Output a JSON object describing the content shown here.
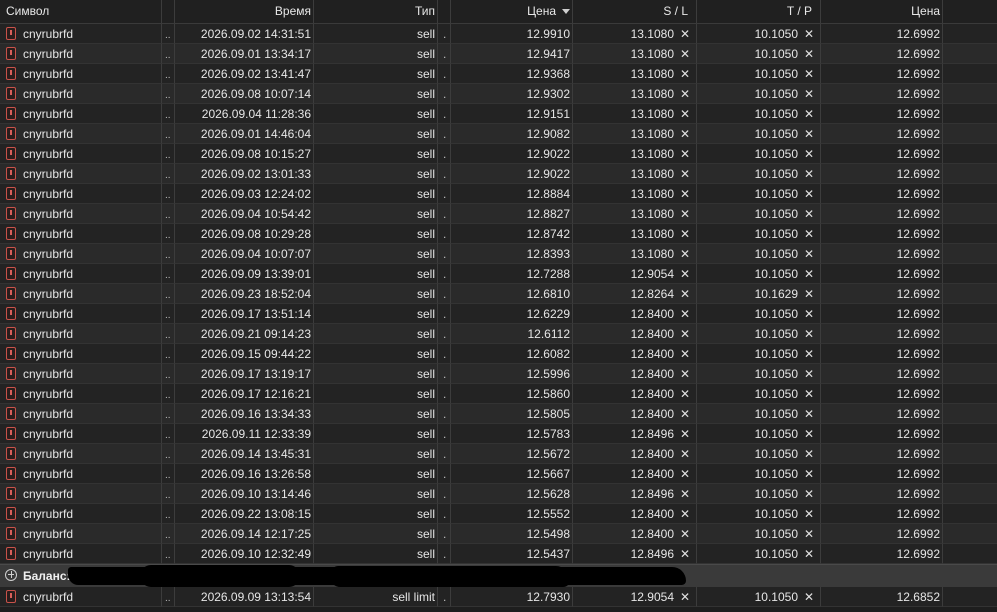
{
  "headers": {
    "symbol": "Символ",
    "time": "Время",
    "type": "Тип",
    "price": "Цена",
    "sl": "S / L",
    "tp": "T / P",
    "current": "Цена"
  },
  "icons": {
    "order_icon": "sell-order-icon",
    "sort_icon": "sort-desc-icon",
    "remove_icon": "close-icon",
    "expand_icon": "plus-circle-icon"
  },
  "rows": [
    {
      "symbol": "cnyrubrfd",
      "time": "2026.09.02 14:31:51",
      "type": "sell",
      "price": "12.9910",
      "sl": "13.1080",
      "tp": "10.1050",
      "current": "12.6992"
    },
    {
      "symbol": "cnyrubrfd",
      "time": "2026.09.01 13:34:17",
      "type": "sell",
      "price": "12.9417",
      "sl": "13.1080",
      "tp": "10.1050",
      "current": "12.6992"
    },
    {
      "symbol": "cnyrubrfd",
      "time": "2026.09.02 13:41:47",
      "type": "sell",
      "price": "12.9368",
      "sl": "13.1080",
      "tp": "10.1050",
      "current": "12.6992"
    },
    {
      "symbol": "cnyrubrfd",
      "time": "2026.09.08 10:07:14",
      "type": "sell",
      "price": "12.9302",
      "sl": "13.1080",
      "tp": "10.1050",
      "current": "12.6992"
    },
    {
      "symbol": "cnyrubrfd",
      "time": "2026.09.04 11:28:36",
      "type": "sell",
      "price": "12.9151",
      "sl": "13.1080",
      "tp": "10.1050",
      "current": "12.6992"
    },
    {
      "symbol": "cnyrubrfd",
      "time": "2026.09.01 14:46:04",
      "type": "sell",
      "price": "12.9082",
      "sl": "13.1080",
      "tp": "10.1050",
      "current": "12.6992"
    },
    {
      "symbol": "cnyrubrfd",
      "time": "2026.09.08 10:15:27",
      "type": "sell",
      "price": "12.9022",
      "sl": "13.1080",
      "tp": "10.1050",
      "current": "12.6992"
    },
    {
      "symbol": "cnyrubrfd",
      "time": "2026.09.02 13:01:33",
      "type": "sell",
      "price": "12.9022",
      "sl": "13.1080",
      "tp": "10.1050",
      "current": "12.6992"
    },
    {
      "symbol": "cnyrubrfd",
      "time": "2026.09.03 12:24:02",
      "type": "sell",
      "price": "12.8884",
      "sl": "13.1080",
      "tp": "10.1050",
      "current": "12.6992"
    },
    {
      "symbol": "cnyrubrfd",
      "time": "2026.09.04 10:54:42",
      "type": "sell",
      "price": "12.8827",
      "sl": "13.1080",
      "tp": "10.1050",
      "current": "12.6992"
    },
    {
      "symbol": "cnyrubrfd",
      "time": "2026.09.08 10:29:28",
      "type": "sell",
      "price": "12.8742",
      "sl": "13.1080",
      "tp": "10.1050",
      "current": "12.6992"
    },
    {
      "symbol": "cnyrubrfd",
      "time": "2026.09.04 10:07:07",
      "type": "sell",
      "price": "12.8393",
      "sl": "13.1080",
      "tp": "10.1050",
      "current": "12.6992"
    },
    {
      "symbol": "cnyrubrfd",
      "time": "2026.09.09 13:39:01",
      "type": "sell",
      "price": "12.7288",
      "sl": "12.9054",
      "tp": "10.1050",
      "current": "12.6992"
    },
    {
      "symbol": "cnyrubrfd",
      "time": "2026.09.23 18:52:04",
      "type": "sell",
      "price": "12.6810",
      "sl": "12.8264",
      "tp": "10.1629",
      "current": "12.6992"
    },
    {
      "symbol": "cnyrubrfd",
      "time": "2026.09.17 13:51:14",
      "type": "sell",
      "price": "12.6229",
      "sl": "12.8400",
      "tp": "10.1050",
      "current": "12.6992"
    },
    {
      "symbol": "cnyrubrfd",
      "time": "2026.09.21 09:14:23",
      "type": "sell",
      "price": "12.6112",
      "sl": "12.8400",
      "tp": "10.1050",
      "current": "12.6992"
    },
    {
      "symbol": "cnyrubrfd",
      "time": "2026.09.15 09:44:22",
      "type": "sell",
      "price": "12.6082",
      "sl": "12.8400",
      "tp": "10.1050",
      "current": "12.6992"
    },
    {
      "symbol": "cnyrubrfd",
      "time": "2026.09.17 13:19:17",
      "type": "sell",
      "price": "12.5996",
      "sl": "12.8400",
      "tp": "10.1050",
      "current": "12.6992"
    },
    {
      "symbol": "cnyrubrfd",
      "time": "2026.09.17 12:16:21",
      "type": "sell",
      "price": "12.5860",
      "sl": "12.8400",
      "tp": "10.1050",
      "current": "12.6992"
    },
    {
      "symbol": "cnyrubrfd",
      "time": "2026.09.16 13:34:33",
      "type": "sell",
      "price": "12.5805",
      "sl": "12.8400",
      "tp": "10.1050",
      "current": "12.6992"
    },
    {
      "symbol": "cnyrubrfd",
      "time": "2026.09.11 12:33:39",
      "type": "sell",
      "price": "12.5783",
      "sl": "12.8496",
      "tp": "10.1050",
      "current": "12.6992"
    },
    {
      "symbol": "cnyrubrfd",
      "time": "2026.09.14 13:45:31",
      "type": "sell",
      "price": "12.5672",
      "sl": "12.8400",
      "tp": "10.1050",
      "current": "12.6992"
    },
    {
      "symbol": "cnyrubrfd",
      "time": "2026.09.16 13:26:58",
      "type": "sell",
      "price": "12.5667",
      "sl": "12.8400",
      "tp": "10.1050",
      "current": "12.6992"
    },
    {
      "symbol": "cnyrubrfd",
      "time": "2026.09.10 13:14:46",
      "type": "sell",
      "price": "12.5628",
      "sl": "12.8496",
      "tp": "10.1050",
      "current": "12.6992"
    },
    {
      "symbol": "cnyrubrfd",
      "time": "2026.09.22 13:08:15",
      "type": "sell",
      "price": "12.5552",
      "sl": "12.8400",
      "tp": "10.1050",
      "current": "12.6992"
    },
    {
      "symbol": "cnyrubrfd",
      "time": "2026.09.14 12:17:25",
      "type": "sell",
      "price": "12.5498",
      "sl": "12.8400",
      "tp": "10.1050",
      "current": "12.6992"
    },
    {
      "symbol": "cnyrubrfd",
      "time": "2026.09.10 12:32:49",
      "type": "sell",
      "price": "12.5437",
      "sl": "12.8496",
      "tp": "10.1050",
      "current": "12.6992"
    }
  ],
  "balance": {
    "label": "Баланс:"
  },
  "pending": {
    "symbol": "cnyrubrfd",
    "time": "2026.09.09 13:13:54",
    "type": "sell limit",
    "price": "12.7930",
    "sl": "12.9054",
    "tp": "10.1050",
    "current": "12.6852"
  },
  "colors": {
    "background": "#1e1e1e",
    "row_alt": "#2a2a2a",
    "balance_bar": "#3a3a3a",
    "sell_icon": "#c8524a"
  }
}
